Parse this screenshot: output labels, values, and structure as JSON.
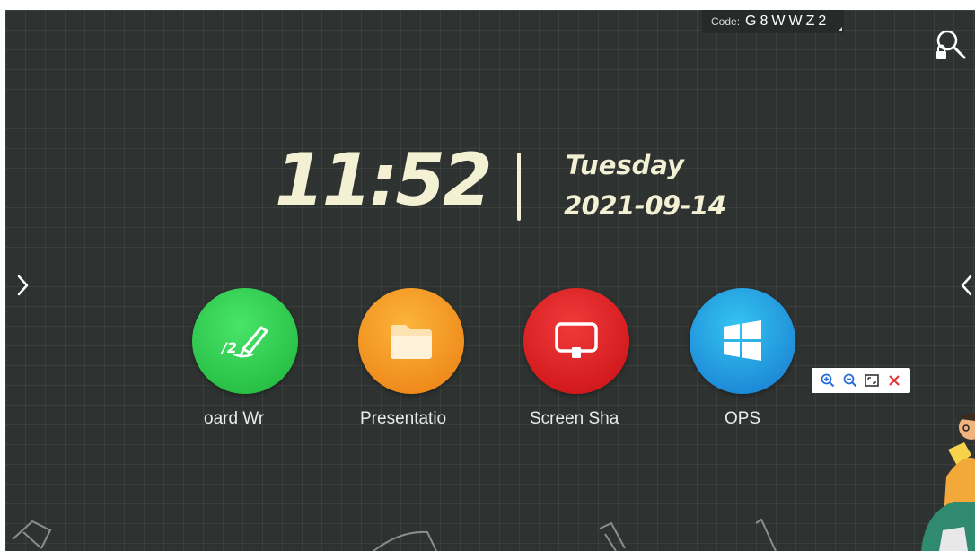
{
  "code": {
    "label": "Code:",
    "value": "G8WWZ2"
  },
  "clock": {
    "time": "11:52",
    "weekday": "Tuesday",
    "date": "2021-09-14"
  },
  "apps": [
    {
      "label": "oard    Wr",
      "icon": "pen-writing-icon",
      "color": "#2ecc40"
    },
    {
      "label": "Presentatio",
      "icon": "folder-icon",
      "color": "#f5a020"
    },
    {
      "label": "Screen Sha",
      "icon": "screen-share-icon",
      "color": "#e0191e"
    },
    {
      "label": "OPS",
      "icon": "windows-icon",
      "color": "#1f9ae0"
    }
  ],
  "zoom_toolbar": {
    "icons": [
      "zoom-in-icon",
      "zoom-out-icon",
      "fullscreen-icon",
      "close-icon"
    ]
  },
  "colors": {
    "background": "#2e3331",
    "clock_text": "#f3f0d4"
  }
}
